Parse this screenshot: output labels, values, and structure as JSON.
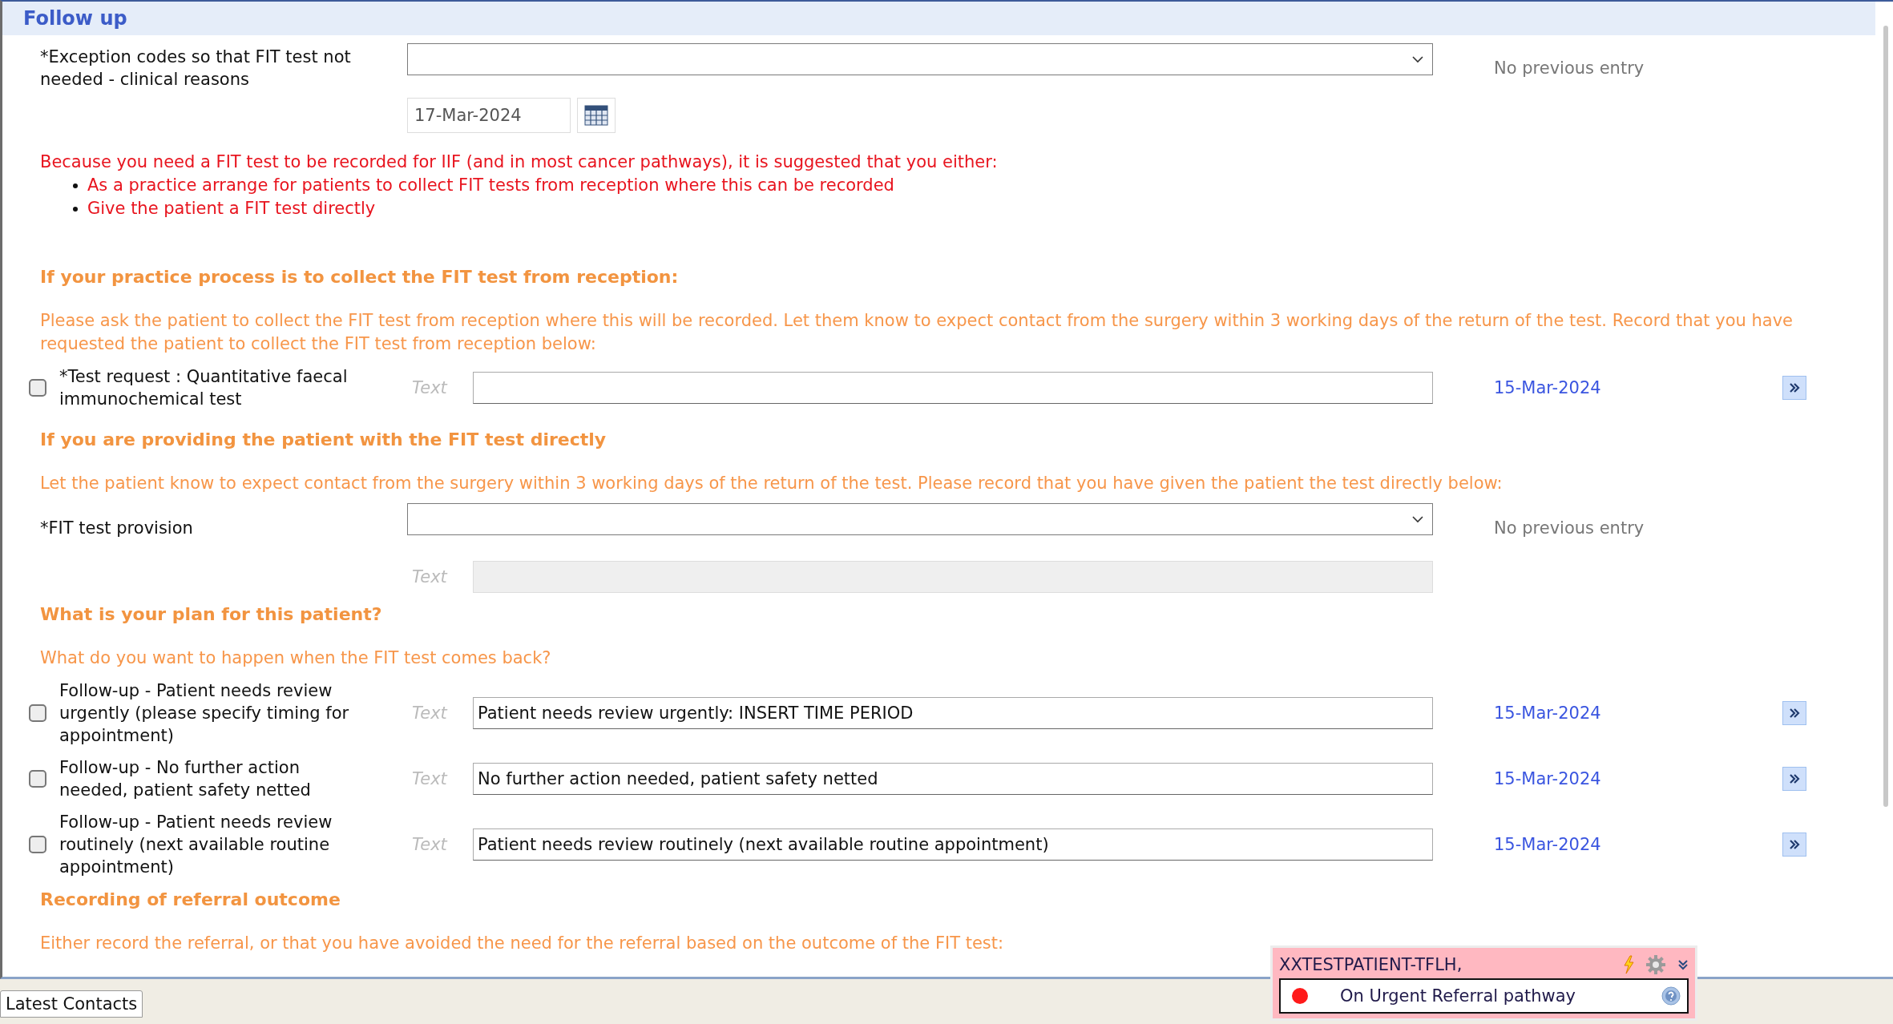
{
  "section": {
    "title": "Follow up"
  },
  "items": [
    {
      "kind": "select",
      "label": "*Exception codes so that FIT test not needed - clinical reasons",
      "previous": "No previous entry"
    },
    {
      "kind": "date",
      "value": "17-Mar-2024"
    },
    {
      "kind": "warning",
      "text": "Because you need a FIT test to be recorded for IIF (and in most cancer pathways), it is suggested that you either:",
      "bullets": [
        "As a practice arrange for patients to collect FIT tests from reception where this can be recorded",
        "Give the patient a FIT test directly"
      ]
    },
    {
      "kind": "heading",
      "text": "If your practice process is to collect the FIT test from reception:"
    },
    {
      "kind": "note",
      "text": "Please ask the patient to collect the FIT test from reception where this will be recorded.  Let them know to expect contact from the surgery within 3 working days of the return of the test.  Record that you have requested the patient to collect the FIT test from reception below:"
    },
    {
      "kind": "check",
      "checked": false,
      "label": "*Test request : Quantitative faecal immunochemical test",
      "placeholder": "Text",
      "value": "",
      "date": "15-Mar-2024"
    },
    {
      "kind": "heading",
      "text": "If you are providing the patient with the FIT test directly"
    },
    {
      "kind": "note",
      "text": "Let the patient know to expect contact from the surgery within 3 working days of the return of the test.  Please record that you have given the patient the test directly below:"
    },
    {
      "kind": "select",
      "label": "*FIT test provision",
      "previous": "No previous entry"
    },
    {
      "kind": "text",
      "disabled": true,
      "placeholder": "Text"
    },
    {
      "kind": "heading",
      "text": "What is your plan for this patient?"
    },
    {
      "kind": "note",
      "text": "What do you want to happen when the FIT test comes back?"
    },
    {
      "kind": "check",
      "checked": false,
      "label": "Follow-up - Patient needs review urgently (please specify timing for appointment)",
      "placeholder": "Text",
      "value": "Patient needs review urgently: INSERT TIME PERIOD",
      "date": "15-Mar-2024"
    },
    {
      "kind": "check",
      "checked": false,
      "label": "Follow-up - No further action needed, patient safety netted",
      "placeholder": "Text",
      "value": "No further action needed, patient safety netted",
      "date": "15-Mar-2024"
    },
    {
      "kind": "check",
      "checked": false,
      "label": "Follow-up - Patient needs review routinely (next available routine appointment)",
      "placeholder": "Text",
      "value": "Patient needs review routinely (next available routine appointment)",
      "date": "15-Mar-2024"
    },
    {
      "kind": "heading",
      "text": "Recording of referral outcome"
    },
    {
      "kind": "note",
      "text": "Either record the referral, or that you have avoided the need for the referral based on the outcome of the FIT test:"
    }
  ],
  "bottom_tabs": [
    {
      "label": "Latest Contacts",
      "selected": true
    }
  ],
  "alert": {
    "patient": "XXTESTPATIENT-TFLH,",
    "status": "On Urgent Referral pathway",
    "color": "#ff1a1a"
  }
}
